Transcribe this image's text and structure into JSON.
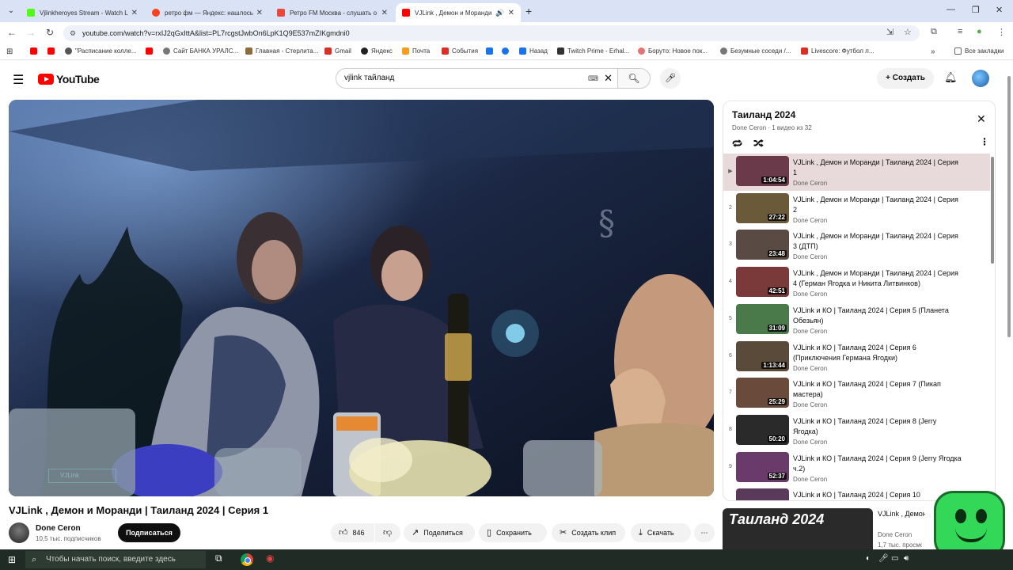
{
  "browser": {
    "tabs": [
      {
        "title": "Vjlinkheroyes Stream - Watch L",
        "fav": "#53fc18"
      },
      {
        "title": "ретро фм — Яндекс: нашлось",
        "fav": "#fc3f1d"
      },
      {
        "title": "Ретро FM Москва - слушать о",
        "fav": "#e8493c"
      },
      {
        "title": "VJLink , Демон и Моранди",
        "fav": "#ff0000"
      }
    ],
    "new_tab": "+",
    "url": "youtube.com/watch?v=rxIJ2qGxIttA&list=PL7rcgstJwbOn6LpK1Q9E537mZIKgmdni0",
    "bookmarks": [
      {
        "label": "",
        "color": "#ff0000"
      },
      {
        "label": "",
        "color": "#ff0000"
      },
      {
        "label": "\"Расписание колле...",
        "color": "#555555"
      },
      {
        "label": "",
        "color": "#ff0000"
      },
      {
        "label": "Сайт БАНКА УРАЛС...",
        "color": "#777777"
      },
      {
        "label": "Главная - Стерлита...",
        "color": "#8a6d3b"
      },
      {
        "label": "Gmail",
        "color": "#d93025"
      },
      {
        "label": "Яндекс",
        "color": "#222222"
      },
      {
        "label": "Почта",
        "color": "#f89c1c"
      },
      {
        "label": "События",
        "color": "#d93025"
      },
      {
        "label": "",
        "color": "#1a73e8"
      },
      {
        "label": "Назад",
        "color": "#1a73e8"
      },
      {
        "label": "Twitch Prime - Erhal...",
        "color": "#333333"
      },
      {
        "label": "Боруто: Новое пок...",
        "color": "#e57373"
      },
      {
        "label": "Безумные соседи /...",
        "color": "#777777"
      },
      {
        "label": "Livescore: Футбол л...",
        "color": "#d93025"
      }
    ],
    "all_bookmarks": "Все закладки"
  },
  "youtube": {
    "logo_text": "YouTube",
    "search_value": "vjlink тайланд",
    "create_label": "Создать"
  },
  "video": {
    "title": "VJLink , Демон и Моранди | Таиланд 2024 | Серия 1",
    "channel": "Done Ceron",
    "subscribers": "10,5 тыс. подписчиков",
    "subscribe_label": "Подписаться",
    "likes": "846",
    "share_label": "Поделиться",
    "save_label": "Сохранить",
    "clip_label": "Создать клип",
    "download_label": "Скачать"
  },
  "playlist": {
    "title": "Таиланд 2024",
    "meta": "Done Ceron · 1 видео из 32",
    "items": [
      {
        "idx": "▶",
        "title": "VJLink , Демон и Моранди | Таиланд 2024 | Серия 1",
        "channel": "Done Ceron",
        "duration": "1:04:54",
        "thumb": "#6b3a4a",
        "current": true
      },
      {
        "idx": "2",
        "title": "VJLink , Демон и Моранди | Таиланд 2024 | Серия 2",
        "channel": "Done Ceron",
        "duration": "27:22",
        "thumb": "#6b5a3a",
        "current": false
      },
      {
        "idx": "3",
        "title": "VJLink , Демон и Моранди | Таиланд 2024 | Серия 3 (ДТП)",
        "channel": "Done Ceron",
        "duration": "23:48",
        "thumb": "#5a4a44",
        "current": false
      },
      {
        "idx": "4",
        "title": "VJLink , Демон и Моранди | Таиланд 2024 | Серия 4 (Герман Ягодка и Никита Литвинков)",
        "channel": "Done Ceron",
        "duration": "42:51",
        "thumb": "#7a3a3a",
        "current": false
      },
      {
        "idx": "5",
        "title": "VJLink и КО | Таиланд 2024 | Серия 5 (Планета Обезьян)",
        "channel": "Done Ceron",
        "duration": "31:09",
        "thumb": "#4a7a4a",
        "current": false
      },
      {
        "idx": "6",
        "title": "VJLink и КО | Таиланд 2024 | Серия 6 (Приключения Германа Ягодки)",
        "channel": "Done Ceron",
        "duration": "1:13:44",
        "thumb": "#5a4a3a",
        "current": false
      },
      {
        "idx": "7",
        "title": "VJLink и КО | Таиланд 2024 | Серия 7 (Пикап мастера)",
        "channel": "Done Ceron",
        "duration": "25:29",
        "thumb": "#6a4a3a",
        "current": false
      },
      {
        "idx": "8",
        "title": "VJLink и КО | Таиланд 2024 | Серия 8 (Jerry Ягодка)",
        "channel": "Done Ceron",
        "duration": "50:20",
        "thumb": "#2a2a2a",
        "current": false
      },
      {
        "idx": "9",
        "title": "VJLink и КО | Таиланд 2024 | Серия 9 (Jerry Ягодка ч.2)",
        "channel": "Done Ceron",
        "duration": "52:37",
        "thumb": "#6a3a6a",
        "current": false
      },
      {
        "idx": "",
        "title": "VJLink и КО | Таиланд 2024 | Серия 10",
        "channel": "",
        "duration": "",
        "thumb": "#5a3a5a",
        "current": false
      }
    ]
  },
  "recommendation": {
    "thumb_text": "Таиланд 2024",
    "title": "VJLink , Демон и Моранди | Таиланд 2024",
    "channel": "Done Ceron",
    "views": "1,7 тыс. просмотров"
  },
  "taskbar": {
    "search_placeholder": "Чтобы начать поиск, введите здесь"
  }
}
